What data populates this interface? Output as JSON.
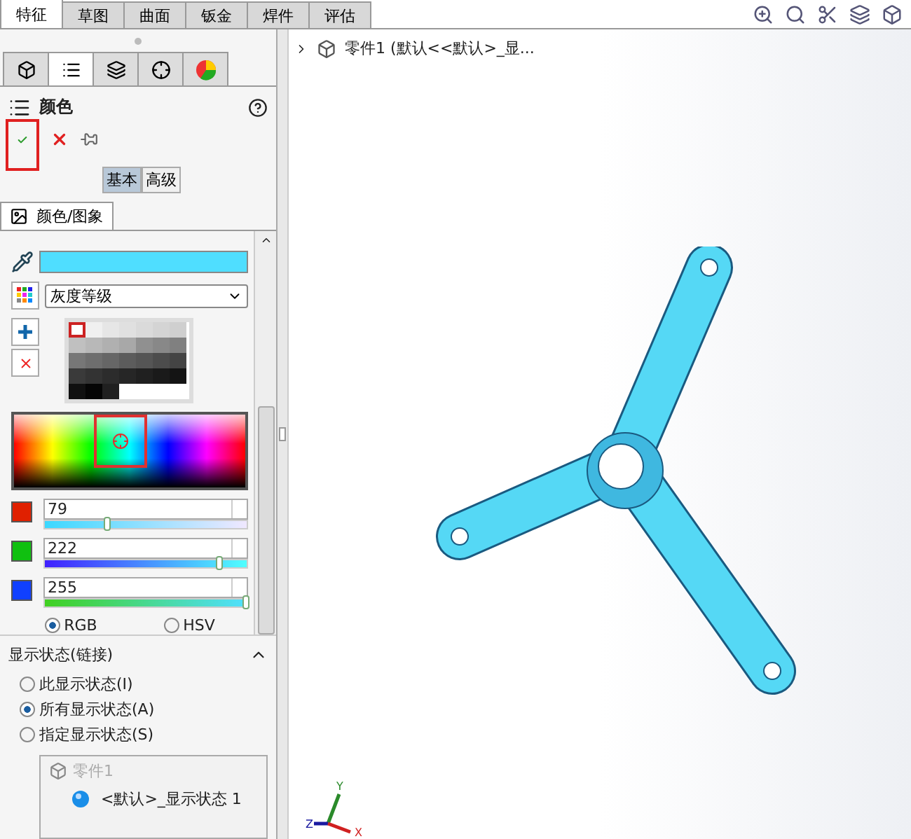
{
  "command_tabs": [
    {
      "label": "特征",
      "selected": true
    },
    {
      "label": "草图",
      "selected": false
    },
    {
      "label": "曲面",
      "selected": false
    },
    {
      "label": "钣金",
      "selected": false
    },
    {
      "label": "焊件",
      "selected": false
    },
    {
      "label": "评估",
      "selected": false
    }
  ],
  "panel_tabs": [
    {
      "kind": "feature",
      "selected": false
    },
    {
      "kind": "property",
      "selected": true
    },
    {
      "kind": "config",
      "selected": false
    },
    {
      "kind": "dim",
      "selected": false
    },
    {
      "kind": "appearance",
      "selected": false
    }
  ],
  "property_manager": {
    "title": "颜色",
    "modes": [
      {
        "label": "基本",
        "selected": true
      },
      {
        "label": "高级",
        "selected": false
      }
    ],
    "subtab": "颜色/图象"
  },
  "color": {
    "palette_dropdown": "灰度等级"
  },
  "channels": [
    {
      "value": "79",
      "level": 0.31
    },
    {
      "value": "222",
      "level": 0.87
    },
    {
      "value": "255",
      "level": 1.0
    }
  ],
  "color_models": [
    {
      "label": "RGB",
      "selected": true
    },
    {
      "label": "HSV",
      "selected": false
    }
  ],
  "display_state": {
    "title": "显示状态(链接)",
    "expanded": true,
    "options": [
      {
        "label": "此显示状态(I)",
        "selected": false
      },
      {
        "label": "所有显示状态(A)",
        "selected": true
      },
      {
        "label": "指定显示状态(S)",
        "selected": false
      }
    ],
    "tree": {
      "part": "零件1",
      "state": "<默认>_显示状态 1"
    }
  },
  "viewport": {
    "tree_label": "零件1  (默认<<默认>_显...",
    "axes": [
      "Y",
      "Z",
      "X"
    ]
  }
}
